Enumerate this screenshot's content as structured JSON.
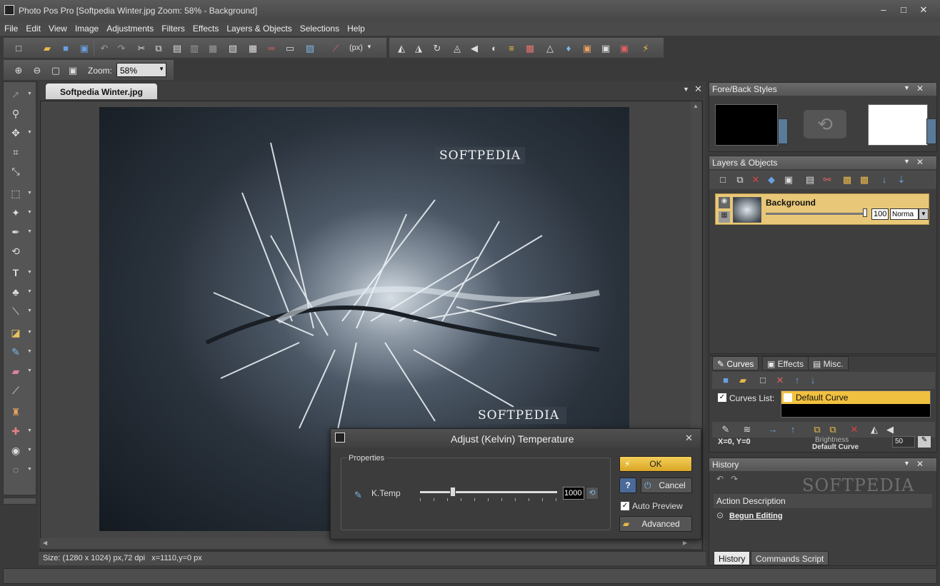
{
  "window": {
    "title": "Photo Pos Pro [Softpedia Winter.jpg Zoom: 58% - Background]",
    "minimize": "–",
    "maximize": "□",
    "close": "✕"
  },
  "menu": [
    "File",
    "Edit",
    "View",
    "Image",
    "Adjustments",
    "Filters",
    "Effects",
    "Layers & Objects",
    "Selections",
    "Help"
  ],
  "toolbar": {
    "units": "(px)",
    "zoom_label": "Zoom:",
    "zoom_value": "58%"
  },
  "document": {
    "tab_name": "Softpedia Winter.jpg",
    "watermark_top": "SOFTPEDIA",
    "watermark_bottom": "SOFTPEDIA",
    "status": "Size: (1280 x 1024) px,72 dpi   x=1110,y=0 px"
  },
  "fore_back": {
    "title": "Fore/Back Styles",
    "fore_color": "#000000",
    "back_color": "#ffffff"
  },
  "layers": {
    "title": "Layers & Objects",
    "layer_name": "Background",
    "opacity": "100",
    "blend": "Norma",
    "opacity_fraction": 1.0
  },
  "curves": {
    "tabs": [
      "Curves",
      "Effects",
      "Misc."
    ],
    "list_label": "Curves List:",
    "item": "Default Curve",
    "coords": "X=0, Y=0",
    "brightness": "Brightness",
    "default_curve": "Default Curve",
    "value": "50"
  },
  "history": {
    "title": "History",
    "column": "Action Description",
    "item": "Begun Editing",
    "tabs": [
      "History",
      "Commands Script"
    ],
    "watermark": "SOFTPEDIA"
  },
  "dialog": {
    "title": "Adjust (Kelvin) Temperature",
    "group": "Properties",
    "param_label": "K.Temp",
    "param_value": "1000",
    "slider_fraction": 0.24,
    "ok": "OK",
    "cancel": "Cancel",
    "help": "?",
    "auto_preview": "Auto Preview",
    "advanced": "Advanced",
    "close": "✕"
  },
  "colors": {
    "accent": "#f0c040",
    "selected_layer": "#e8c878"
  }
}
